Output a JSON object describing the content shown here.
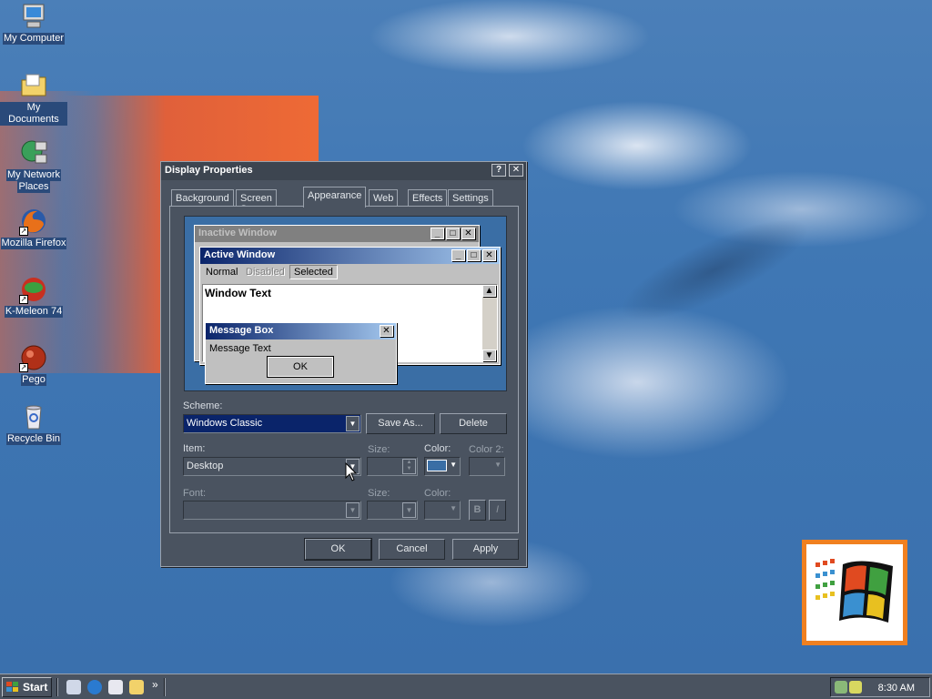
{
  "desktop": {
    "icons": [
      {
        "label": "My Computer",
        "icon": "computer-icon"
      },
      {
        "label": "My Documents",
        "icon": "folder-icon"
      },
      {
        "label": "My Network",
        "label2": "Places",
        "icon": "network-icon"
      },
      {
        "label": "Mozilla Firefox",
        "icon": "firefox-icon"
      },
      {
        "label": "K-Meleon 74",
        "icon": "kmeleon-icon"
      },
      {
        "label": "Pego",
        "icon": "pego-icon"
      },
      {
        "label": "Recycle Bin",
        "icon": "recycle-bin-icon"
      }
    ]
  },
  "dialog": {
    "title": "Display Properties",
    "help_btn": "?",
    "close_btn": "✕",
    "tabs": [
      "Background",
      "Screen Saver",
      "Appearance",
      "Web",
      "Effects",
      "Settings"
    ],
    "active_tab": "Appearance",
    "preview": {
      "inactive_title": "Inactive Window",
      "active_title": "Active Window",
      "menu": [
        "Normal",
        "Disabled",
        "Selected"
      ],
      "window_text": "Window Text",
      "msgbox_title": "Message Box",
      "msgbox_text": "Message Text",
      "msgbox_ok": "OK"
    },
    "scheme_label": "Scheme:",
    "scheme_value": "Windows Classic",
    "save_as": "Save As...",
    "delete": "Delete",
    "item_label": "Item:",
    "item_value": "Desktop",
    "size_label": "Size:",
    "color_label": "Color:",
    "color2_label": "Color 2:",
    "font_label": "Font:",
    "size2_label": "Size:",
    "color3_label": "Color:",
    "bold_btn": "B",
    "italic_btn": "I",
    "item_color": "#3a6ea5",
    "ok": "OK",
    "cancel": "Cancel",
    "apply": "Apply"
  },
  "taskbar": {
    "start": "Start",
    "chevron": "»",
    "clock": "8:30 AM"
  }
}
